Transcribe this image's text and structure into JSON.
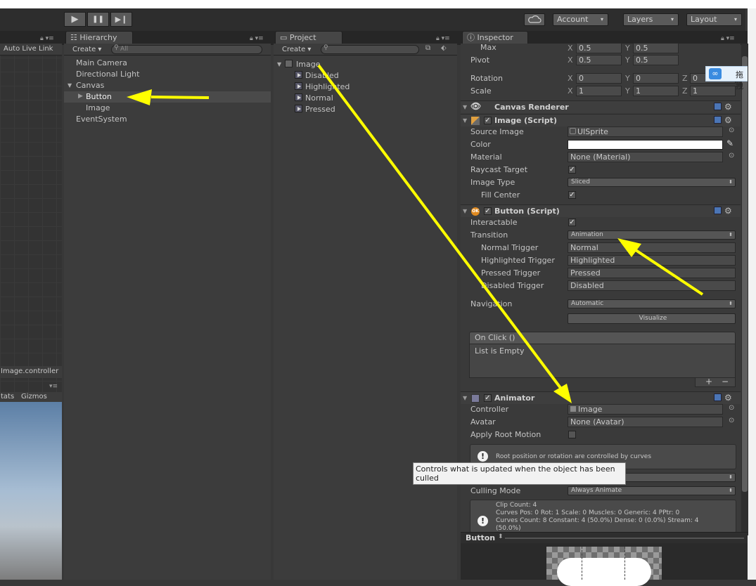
{
  "toolbar": {
    "play": "▶",
    "pause": "❚❚",
    "step": "▶❙",
    "cloud_icon": "cloud-icon",
    "account": "Account",
    "layers": "Layers",
    "layout": "Layout",
    "dropdown_arrow": "▾"
  },
  "left_strip": {
    "auto_live_link": "Auto Live Link",
    "controller_label": "Image.controller",
    "stats": "tats",
    "gizmos": "Gizmos"
  },
  "hierarchy": {
    "tab": "Hierarchy",
    "create": "Create",
    "search_placeholder": "All",
    "items": [
      "Main Camera",
      "Directional Light",
      "Canvas",
      "Button",
      "Image",
      "EventSystem"
    ]
  },
  "project": {
    "tab": "Project",
    "create": "Create",
    "root": "Image",
    "items": [
      "Disabled",
      "Highlighted",
      "Normal",
      "Pressed"
    ]
  },
  "inspector": {
    "tab": "Inspector",
    "max_label": "Max",
    "max_x": "0.5",
    "max_y": "0.5",
    "pivot_label": "Pivot",
    "pivot_x": "0.5",
    "pivot_y": "0.5",
    "rotation_label": "Rotation",
    "rot_x": "0",
    "rot_y": "0",
    "rot_z": "0",
    "scale_label": "Scale",
    "scale_x": "1",
    "scale_y": "1",
    "scale_z": "1",
    "axis_x": "X",
    "axis_y": "Y",
    "axis_z": "Z",
    "canvas_renderer": "Canvas Renderer",
    "image_script": {
      "title": "Image (Script)",
      "source_image_label": "Source Image",
      "source_image": "UISprite",
      "color_label": "Color",
      "material_label": "Material",
      "material": "None (Material)",
      "raycast_label": "Raycast Target",
      "image_type_label": "Image Type",
      "image_type": "Sliced",
      "fill_center_label": "Fill Center"
    },
    "button_script": {
      "title": "Button (Script)",
      "interactable_label": "Interactable",
      "transition_label": "Transition",
      "transition": "Animation",
      "normal_trigger_label": "Normal Trigger",
      "normal_trigger": "Normal",
      "highlighted_trigger_label": "Highlighted Trigger",
      "highlighted_trigger": "Highlighted",
      "pressed_trigger_label": "Pressed Trigger",
      "pressed_trigger": "Pressed",
      "disabled_trigger_label": "Disabled Trigger",
      "disabled_trigger": "Disabled",
      "navigation_label": "Navigation",
      "navigation": "Automatic",
      "visualize": "Visualize",
      "onclick_header": "On Click ()",
      "list_empty": "List is Empty",
      "plus": "+",
      "minus": "−"
    },
    "animator": {
      "title": "Animator",
      "controller_label": "Controller",
      "controller": "Image",
      "avatar_label": "Avatar",
      "avatar": "None (Avatar)",
      "apply_root_label": "Apply Root Motion",
      "root_help": "Root position or rotation are controlled by curves",
      "culling_label": "Culling Mode",
      "culling": "Always Animate",
      "stats_lines": [
        "Clip Count: 4",
        "Curves Pos: 0 Rot: 1 Scale: 0 Muscles: 0 Generic: 4 PPtr: 0",
        "Curves Count: 8 Constant: 4 (50.0%) Dense: 0 (0.0%) Stream: 4",
        "(50.0%)"
      ]
    },
    "preview_label": "Button"
  },
  "tooltip": "Controls what is updated when the object has been culled",
  "floating": {
    "label": "拖拽"
  },
  "colors": {
    "arrow": "#ffff00",
    "accent": "#4b75b5"
  }
}
